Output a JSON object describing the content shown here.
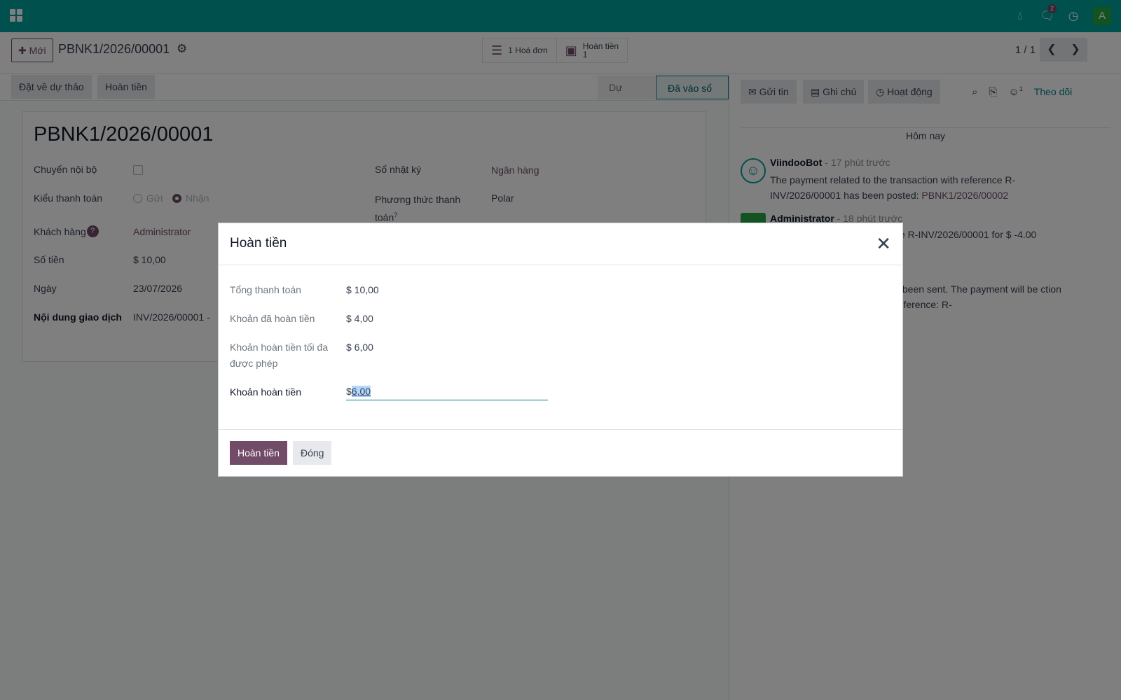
{
  "navbar": {
    "icons": [
      "apps-icon",
      "drop-icon",
      "chat-icon",
      "clock-icon"
    ],
    "messages_badge": "2",
    "avatar_letter": "A"
  },
  "control": {
    "new_label": "✚ Mới",
    "record_title": "PBNK1/2026/00001",
    "invoice_button": "1 Hoá đơn",
    "refund_button_label": "Hoàn tiền",
    "refund_button_count": "1",
    "pager": "1 / 1"
  },
  "statusbar": {
    "reset_label": "Đặt về dự thảo",
    "refund_label": "Hoàn tiền",
    "stages": [
      "Dự thảo",
      "Đã vào sổ"
    ]
  },
  "form": {
    "title": "PBNK1/2026/00001",
    "internal_transfer_label": "Chuyển nội bộ",
    "payment_type_label": "Kiểu thanh toán",
    "payment_type_send": "Gửi",
    "payment_type_receive": "Nhận",
    "customer_label": "Khách hàng",
    "customer_help": "?",
    "customer_value": "Administrator",
    "amount_label": "Số tiền",
    "amount_value": "$ 10,00",
    "date_label": "Ngày",
    "date_value": "23/07/2026",
    "memo_label": "Nội dung giao dịch",
    "memo_value": "INV/2026/00001 -",
    "journal_label": "Sổ nhật ký",
    "journal_value": "Ngân hàng",
    "method_label": "Phương thức thanh toán",
    "method_help": "?",
    "method_value": "Polar"
  },
  "chatter": {
    "send_message": "Gửi tin",
    "log_note": "Ghi chú",
    "activities": "Hoạt động",
    "followers_count": "1",
    "follow_label": "Theo dõi",
    "today": "Hôm nay",
    "messages": [
      {
        "author": "ViindooBot",
        "time": "- 17 phút trước",
        "body_text": "The payment related to the transaction with reference R-INV/2026/00001 has been posted: ",
        "body_link": "PBNK1/2026/00002"
      },
      {
        "author": "Administrator",
        "time": "- 18 phút trước",
        "body_text": "ce R-INV/2026/00001 for $ -4.00"
      },
      {
        "body_text": "s been sent. The payment will be ction reference: R-"
      }
    ]
  },
  "dialog": {
    "title": "Hoàn tiền",
    "total_label": "Tổng thanh toán",
    "total_value": "$ 10,00",
    "refunded_label": "Khoản đã hoàn tiền",
    "refunded_value": "$ 4,00",
    "max_label": "Khoản hoàn tiền tối đa được phép",
    "max_value": "$ 6,00",
    "amount_label": "Khoản hoàn tiền",
    "amount_currency": "$",
    "amount_value": "6,00",
    "confirm_label": "Hoàn tiền",
    "close_label": "Đóng"
  },
  "colors": {
    "navbar": "#00a09d",
    "primary": "#714b67",
    "accent": "#017e84"
  }
}
